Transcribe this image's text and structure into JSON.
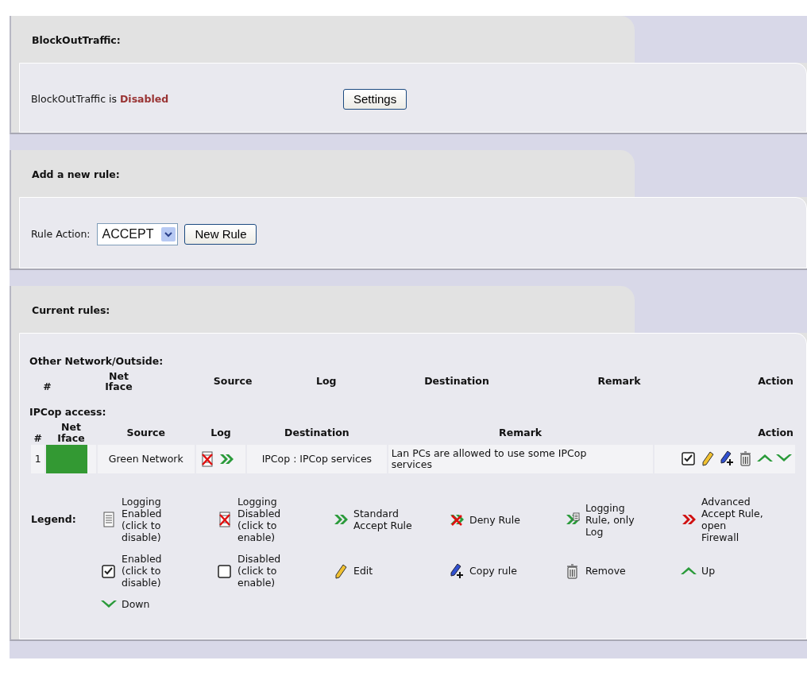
{
  "panels": [
    {
      "kind": "status",
      "title": "BlockOutTraffic:",
      "label": "BlockOutTraffic is",
      "status": "Disabled",
      "button": "Settings"
    },
    {
      "kind": "newrule",
      "title": "Add a new rule:",
      "label": "Rule Action:",
      "select_value": "ACCEPT",
      "button": "New Rule"
    },
    {
      "kind": "rules",
      "title": "Current rules:",
      "sections": [
        {
          "title": "Other Network/Outside:",
          "columns": [
            "#",
            "Net Iface",
            "Source",
            "Log",
            "Destination",
            "Remark",
            "Action"
          ]
        },
        {
          "title": "IPCop access:",
          "columns": [
            "#",
            "Net Iface",
            "Source",
            "Log",
            "Destination",
            "Remark",
            "Action"
          ],
          "rows": [
            {
              "number": "1",
              "color": "#339933",
              "source": "Green Network",
              "logging": false,
              "kind": "accept",
              "destination": "IPCop : IPCop services",
              "remark": "Lan PCs are allowed to use some IPCop services",
              "enabled": true
            }
          ]
        }
      ],
      "legend": {
        "title": "Legend:",
        "items": [
          {
            "kind": "log-on",
            "text": "Logging Enabled (click to disable)"
          },
          {
            "kind": "log-off",
            "text": "Logging Disabled (click to enable)"
          },
          {
            "kind": "accept",
            "text": "Standard Accept Rule"
          },
          {
            "kind": "deny",
            "text": "Deny Rule"
          },
          {
            "kind": "logrule",
            "text": "Logging Rule, only Log"
          },
          {
            "kind": "advanced",
            "text": "Advanced Accept Rule, open Firewall"
          },
          {
            "kind": "checked",
            "text": "Enabled (click to disable)"
          },
          {
            "kind": "unchecked",
            "text": "Disabled (click to enable)"
          },
          {
            "kind": "edit",
            "text": "Edit"
          },
          {
            "kind": "copy",
            "text": "Copy rule"
          },
          {
            "kind": "remove",
            "text": "Remove"
          },
          {
            "kind": "up",
            "text": "Up"
          },
          {
            "kind": "down",
            "text": "Down"
          }
        ]
      }
    }
  ]
}
